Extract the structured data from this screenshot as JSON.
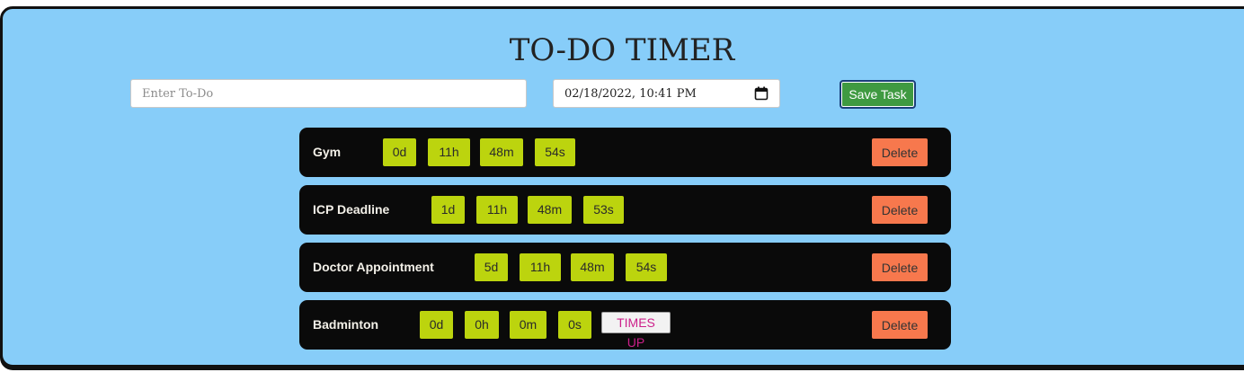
{
  "header": {
    "title": "TO-DO TIMER"
  },
  "form": {
    "todo_placeholder": "Enter To-Do",
    "todo_value": "",
    "date_value": "02/18/2022, 10:41 PM",
    "save_label": "Save Task"
  },
  "tasks": [
    {
      "name": "Gym",
      "days": "0d",
      "hours": "11h",
      "minutes": "48m",
      "seconds": "54s",
      "delete_label": "Delete"
    },
    {
      "name": "ICP Deadline",
      "days": "1d",
      "hours": "11h",
      "minutes": "48m",
      "seconds": "53s",
      "delete_label": "Delete"
    },
    {
      "name": "Doctor Appointment",
      "days": "5d",
      "hours": "11h",
      "minutes": "48m",
      "seconds": "54s",
      "delete_label": "Delete"
    },
    {
      "name": "Badminton",
      "days": "0d",
      "hours": "0h",
      "minutes": "0m",
      "seconds": "0s",
      "status": "TIMES UP",
      "delete_label": "Delete"
    }
  ],
  "colors": {
    "background": "#87cdf9",
    "task_bg": "#0a0a0a",
    "chip": "#bcd40e",
    "delete": "#f7784d",
    "save": "#3f9a41",
    "times_up_text": "#cc1f8a"
  },
  "icons": {
    "date_picker": "calendar-icon"
  }
}
